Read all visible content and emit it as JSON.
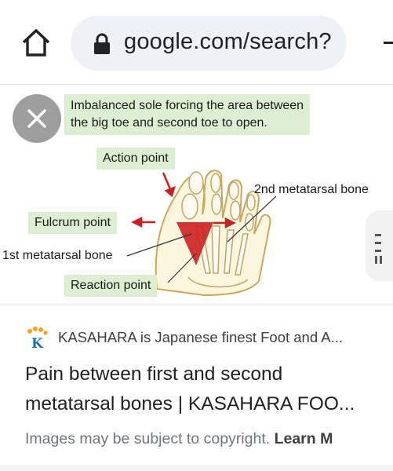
{
  "browser": {
    "url": "google.com/search?",
    "icons": {
      "home": "home-icon",
      "lock": "lock-icon",
      "menu": "tab-menu-icon"
    }
  },
  "image": {
    "caption": "Imbalanced sole forcing the area between\nthe big toe and second toe to open.",
    "labels": {
      "action": "Action point",
      "second_metatarsal": "2nd metatarsal bone",
      "fulcrum": "Fulcrum point",
      "first_metatarsal": "1st metatarsal bone",
      "reaction": "Reaction point"
    },
    "colors": {
      "label_bg": "#dcefd0",
      "accent": "#cc1f1f"
    }
  },
  "result": {
    "source": "KASAHARA is Japanese finest Foot and A...",
    "title": "Pain between first and second\nmetatarsal bones | KASAHARA FOO...",
    "copyright": "Images may be subject to copyright.",
    "learn_more": "Learn M"
  }
}
